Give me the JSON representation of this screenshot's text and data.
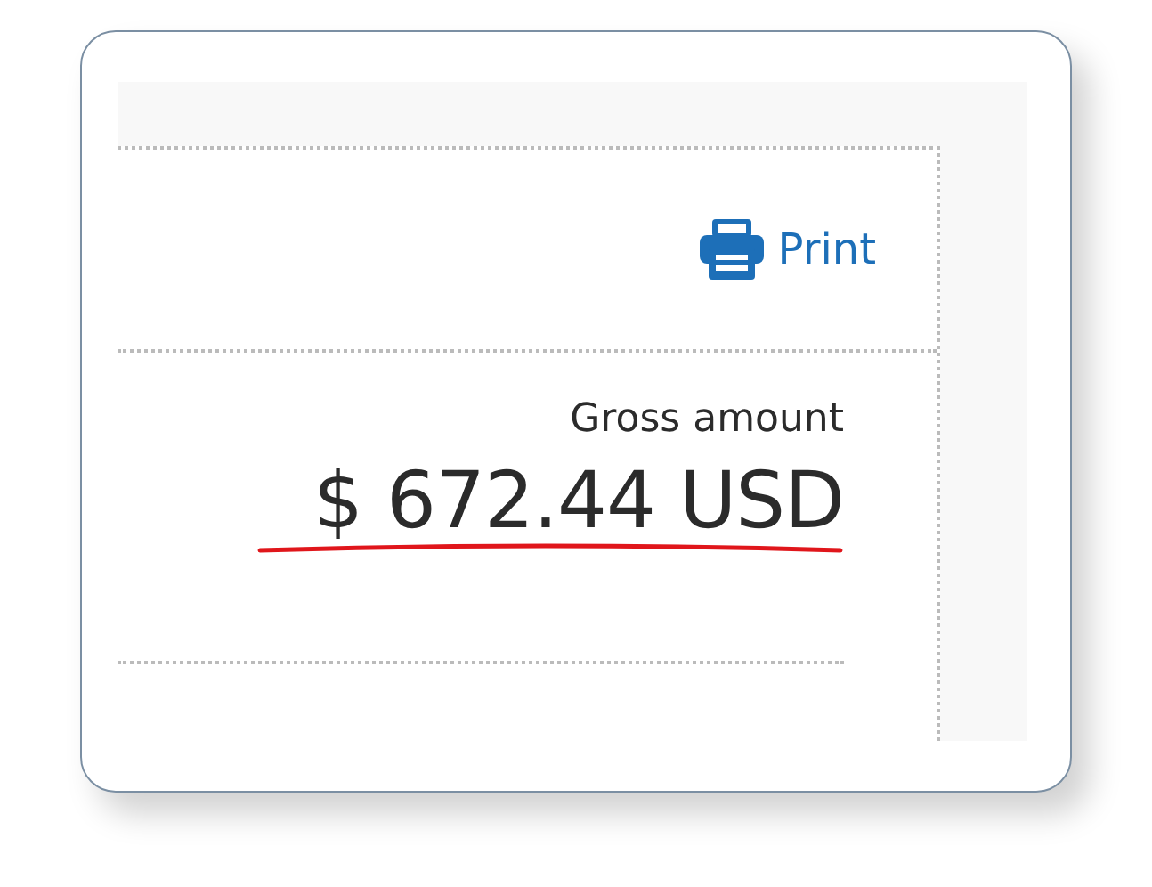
{
  "print_button": {
    "label": "Print"
  },
  "amount": {
    "label": "Gross amount",
    "value": "$ 672.44 USD"
  }
}
